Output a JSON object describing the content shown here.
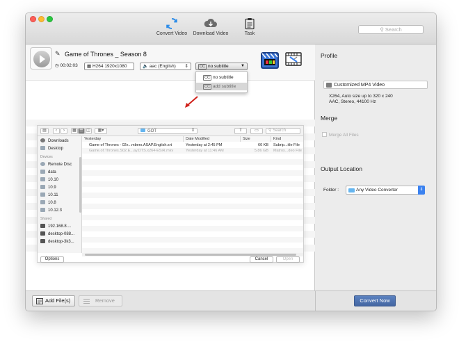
{
  "toolbar": {
    "convert_video": "Convert Video",
    "download_video": "Download Video",
    "task": "Task",
    "search_placeholder": "Search"
  },
  "file": {
    "title": "Game of Thrones _ Season 8",
    "duration": "00:02:03",
    "video": "H264 1920x1080",
    "audio": "aac (English)",
    "subtitle": "no subtitle",
    "cc_label": "CC"
  },
  "subtitle_menu": {
    "options": [
      "no subtitle",
      "add subtitle"
    ]
  },
  "dialog": {
    "folder": "GOT",
    "search_placeholder": "Search",
    "favorites": [
      "Downloads",
      "Desktop"
    ],
    "devices_header": "Devices",
    "devices": [
      "Remote Disc",
      "data",
      "10.10",
      "10.9",
      "10.11",
      "10.8",
      "10.12.3"
    ],
    "shared_header": "Shared",
    "shared": [
      "192.168.8....",
      "desktop-088...",
      "desktop-3k3..."
    ],
    "columns": [
      "Yesterday",
      "Date Modified",
      "Size",
      "Kind"
    ],
    "rows": [
      {
        "name": "Game of Thrones - 02x...mbers.ASAP.English.srt",
        "date": "Yesterday at 2:45 PM",
        "size": "60 KB",
        "kind": "Subrip...itle File"
      },
      {
        "name": "Game.of.Thrones.S02.E...ay.DTS.x264-ESiR.mkv",
        "date": "Yesterday at 11:46 AM",
        "size": "5.86 GB",
        "kind": "Matros...deo File"
      }
    ],
    "options_label": "Options",
    "cancel_label": "Cancel",
    "open_label": "Open"
  },
  "profile": {
    "heading": "Profile",
    "selected": "Customized MP4 Video",
    "desc_line1": "X264, Auto size up to 320 x 240",
    "desc_line2": "AAC, Stereo, 44100 Hz"
  },
  "merge": {
    "heading": "Merge",
    "label": "Merge All Files"
  },
  "output": {
    "heading": "Output Location",
    "folder_label": "Folder :",
    "folder_value": "Any Video Converter"
  },
  "bottom": {
    "add_files": "Add File(s)",
    "remove": "Remove",
    "convert_now": "Convert Now"
  },
  "colors": {
    "accent": "#4a6ca8",
    "folder_blue": "#65b5ef",
    "arrow_red": "#d0201a"
  }
}
